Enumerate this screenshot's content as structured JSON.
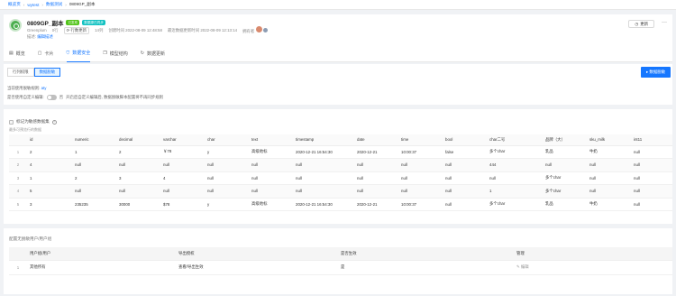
{
  "breadcrumb": [
    "概览页",
    "wytest",
    "数据测试",
    "0809GP_副本"
  ],
  "header": {
    "title": "0809GP_副本",
    "badge1": "已发布",
    "badge2": "数据源已同步",
    "badge1_color": "#52c41a",
    "badge2_color": "#13c2c2",
    "source": "Greenplum",
    "count": "0行",
    "pill": "行数更新",
    "cols": "14列",
    "created_label": "创建时间",
    "created": "2022-08-09 12:48:58",
    "updated_label": "最近数据更新时间",
    "updated": "2022-08-09 12:13:14",
    "owner_label": "拥有者",
    "desc_label": "描述:",
    "desc_value": "编辑描述",
    "share": "更新",
    "more": "···"
  },
  "tabs": [
    {
      "label": "概览",
      "icon": "overview-icon"
    },
    {
      "label": "卡片",
      "icon": "card-icon"
    },
    {
      "label": "数据安全",
      "icon": "shield-icon",
      "active": true
    },
    {
      "label": "模型结构",
      "icon": "cube-icon"
    },
    {
      "label": "数据更新",
      "icon": "refresh-icon"
    }
  ],
  "subtabs": [
    "行列权限",
    "数据脱敏"
  ],
  "primary_button": "数据脱敏",
  "rule_label": "当前使用脱敏规则:",
  "rule_value": "aty",
  "custom_label": "是否使用自定义编辑:",
  "custom_value": "否",
  "custom_hint": "开启后自定义编辑后, 数据脱敏脚本配置将不再同步规则",
  "sensitive_label": "标记为敏感数据集",
  "preview_hint": "最多可预览行的数据",
  "table": {
    "columns": [
      "",
      "id",
      "numeric",
      "decimal",
      "varchar",
      "char",
      "text",
      "timestamp",
      "date",
      "time",
      "bool",
      "char二号",
      "品牌（大）",
      "sku_milk",
      "int11"
    ],
    "rows": [
      [
        "1",
        "2",
        "1",
        "2",
        "￥78",
        "y",
        "高级地标",
        "2020-12-21 16:54:30",
        "2020-12-21",
        "10:00:37",
        "false",
        "多个char",
        "乳品",
        "牛奶",
        "null"
      ],
      [
        "2",
        "4",
        "null",
        "null",
        "null",
        "null",
        "null",
        "null",
        "null",
        "null",
        "null",
        "444",
        "null",
        "null",
        "null"
      ],
      [
        "3",
        "1",
        "2",
        "3",
        "4",
        "null",
        "null",
        "null",
        "null",
        "null",
        "null",
        "null",
        "多个char",
        "null",
        "null"
      ],
      [
        "4",
        "5",
        "null",
        "null",
        "null",
        "null",
        "null",
        "null",
        "null",
        "null",
        "null",
        "1",
        "多个char",
        "null",
        "null"
      ],
      [
        "5",
        "3",
        "235235",
        "30000",
        "$78",
        "y",
        "高级地标",
        "2020-12-21 16:54:30",
        "2020-12-21",
        "10:00:37",
        "null",
        "多个char",
        "乳品",
        "牛奶",
        "null"
      ]
    ]
  },
  "users_title": "配置无脱敏用户/用户组",
  "users_table": {
    "columns": [
      "",
      "用户组/用户",
      "导出授权",
      "是否生效",
      "管理"
    ],
    "rows": [
      [
        "1",
        "其他所有",
        "查看/导出生效",
        "是",
        "编辑"
      ]
    ]
  }
}
